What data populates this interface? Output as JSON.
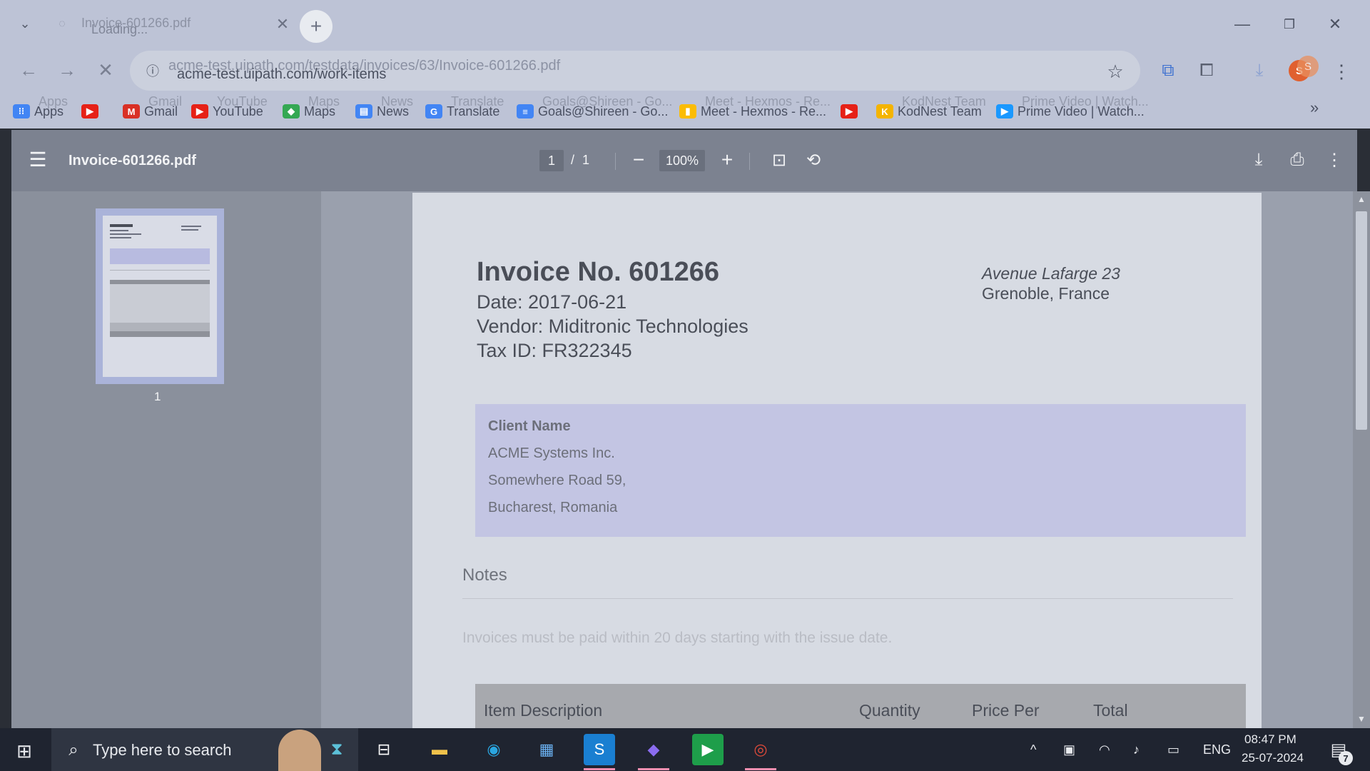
{
  "browser": {
    "tab": {
      "title": "Invoice-601266.pdf",
      "loading_text": "Loading..."
    },
    "url_overlay": "acme-test.uipath.com/testdata/invoices/63/Invoice-601266.pdf",
    "url": "acme-test.uipath.com/work-items",
    "profile_initial": "S",
    "profile_initial_ghost": "S",
    "bookmarks": [
      {
        "label": "Apps",
        "ghost": "Apps",
        "icon": "apps-grid-icon",
        "color": "#4285f4"
      },
      {
        "label": "",
        "ghost": "",
        "icon": "youtube-icon",
        "color": "#e62117"
      },
      {
        "label": "Gmail",
        "ghost": "Gmail",
        "icon": "gmail-icon",
        "color": "#d93025"
      },
      {
        "label": "YouTube",
        "ghost": "YouTube",
        "icon": "youtube-icon",
        "color": "#e62117"
      },
      {
        "label": "Maps",
        "ghost": "Maps",
        "icon": "maps-icon",
        "color": "#34a853"
      },
      {
        "label": "News",
        "ghost": "News",
        "icon": "news-icon",
        "color": "#4285f4"
      },
      {
        "label": "Translate",
        "ghost": "Translate",
        "icon": "translate-icon",
        "color": "#4285f4"
      },
      {
        "label": "Goals@Shireen - Go...",
        "ghost": "Goals@Shireen - Go...",
        "icon": "docs-icon",
        "color": "#4285f4"
      },
      {
        "label": "Meet - Hexmos - Re...",
        "ghost": "Meet - Hexmos - Re...",
        "icon": "meet-icon",
        "color": "#fbbc04"
      },
      {
        "label": "",
        "ghost": "",
        "icon": "youtube-icon",
        "color": "#e62117"
      },
      {
        "label": "KodNest Team",
        "ghost": "KodNest Team",
        "icon": "kodnest-icon",
        "color": "#f4b400"
      },
      {
        "label": "Prime Video | Watch...",
        "ghost": "Prime Video | Watch...",
        "icon": "prime-video-icon",
        "color": "#1a98ff"
      }
    ],
    "bookmarks_more": "»"
  },
  "pdf": {
    "file_name": "Invoice-601266.pdf",
    "page_current": "1",
    "page_separator": "/",
    "page_total": "1",
    "zoom": "100%",
    "thumbnail_label": "1"
  },
  "invoice": {
    "title": "Invoice No. 601266",
    "date": "Date: 2017-06-21",
    "vendor": "Vendor: Miditronic Technologies",
    "tax_id": "Tax ID: FR322345",
    "address_line1": "Avenue Lafarge 23",
    "address_line2": "Grenoble, France",
    "client": {
      "label": "Client Name",
      "lines": [
        "ACME Systems Inc.",
        "Somewhere Road 59,",
        "Bucharest, Romania"
      ]
    },
    "notes_heading": "Notes",
    "notes_text": "Invoices must be paid within 20 days starting with the issue date.",
    "table_headers": [
      "Item Description",
      "Quantity",
      "Price Per",
      "Total"
    ]
  },
  "taskbar": {
    "search_placeholder": "Type here to search",
    "language": "ENG",
    "time": "08:47 PM",
    "date": "25-07-2024",
    "notification_count": "7"
  }
}
